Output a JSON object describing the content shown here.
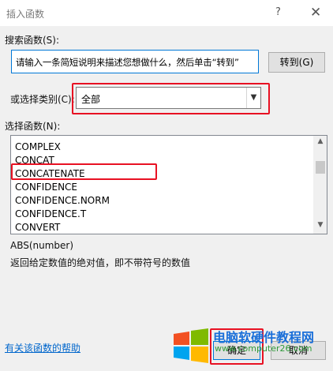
{
  "window": {
    "title": "插入函数",
    "help": "?",
    "close": "✕"
  },
  "search": {
    "label": "搜索函数(S):",
    "value": "请输入一条简短说明来描述您想做什么，然后单击“转到”",
    "go_button": "转到(G)"
  },
  "category": {
    "label": "或选择类别(C):",
    "value": "全部"
  },
  "function_list": {
    "label": "选择函数(N):",
    "items": [
      "COMPLEX",
      "CONCAT",
      "CONCATENATE",
      "CONFIDENCE",
      "CONFIDENCE.NORM",
      "CONFIDENCE.T",
      "CONVERT"
    ]
  },
  "description": {
    "signature": "ABS(number)",
    "text": "返回给定数值的绝对值，即不带符号的数值"
  },
  "footer": {
    "help_link": "有关该函数的帮助",
    "ok": "确定",
    "cancel": "取消"
  },
  "watermark": {
    "text": "电脑软硬件教程网",
    "url": "www.computer26.com"
  },
  "colors": {
    "highlight": "#e81123",
    "link": "#0066cc",
    "focus": "#0078d7"
  }
}
